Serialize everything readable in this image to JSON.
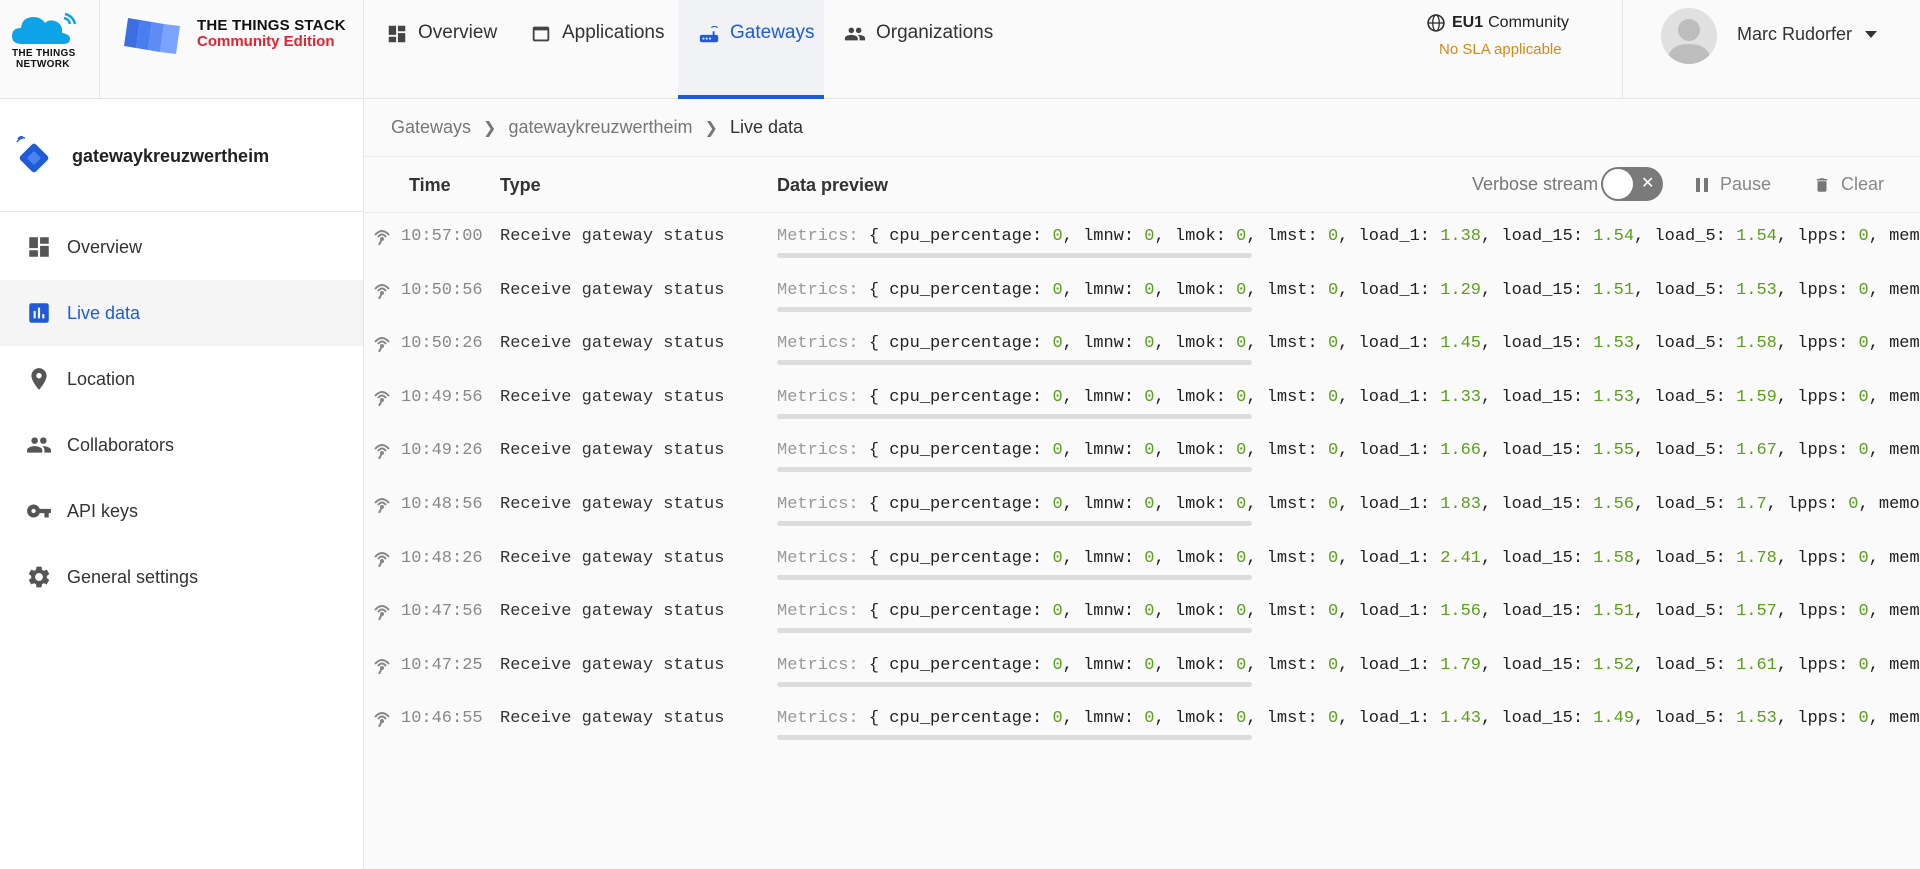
{
  "header": {
    "ttn_logo_text": [
      "THE THINGS",
      "NETWORK"
    ],
    "stack_title": "THE THINGS STACK",
    "stack_subtitle": "Community Edition",
    "nav": [
      {
        "label": "Overview",
        "icon": "dashboard-icon",
        "active": false
      },
      {
        "label": "Applications",
        "icon": "window-icon",
        "active": false
      },
      {
        "label": "Gateways",
        "icon": "router-icon",
        "active": true
      },
      {
        "label": "Organizations",
        "icon": "people-icon",
        "active": false
      }
    ],
    "cluster_name": "EU1",
    "cluster_type": "Community",
    "sla_text": "No SLA applicable",
    "user_name": "Marc Rudorfer"
  },
  "sidebar": {
    "entity_name": "gatewaykreuzwertheim",
    "items": [
      {
        "label": "Overview",
        "icon": "dashboard-icon",
        "active": false
      },
      {
        "label": "Live data",
        "icon": "bar-chart-icon",
        "active": true
      },
      {
        "label": "Location",
        "icon": "location-pin-icon",
        "active": false
      },
      {
        "label": "Collaborators",
        "icon": "people-icon",
        "active": false
      },
      {
        "label": "API keys",
        "icon": "key-icon",
        "active": false
      },
      {
        "label": "General settings",
        "icon": "gear-icon",
        "active": false
      }
    ]
  },
  "breadcrumb": [
    "Gateways",
    "gatewaykreuzwertheim",
    "Live data"
  ],
  "table": {
    "headers": {
      "time": "Time",
      "type": "Type",
      "preview": "Data preview"
    },
    "verbose_label": "Verbose stream",
    "pause_label": "Pause",
    "clear_label": "Clear",
    "rows": [
      {
        "time": "10:57:00",
        "type": "Receive gateway status",
        "load_1": "1.38",
        "load_15": "1.54",
        "load_5": "1.54"
      },
      {
        "time": "10:50:56",
        "type": "Receive gateway status",
        "load_1": "1.29",
        "load_15": "1.51",
        "load_5": "1.53"
      },
      {
        "time": "10:50:26",
        "type": "Receive gateway status",
        "load_1": "1.45",
        "load_15": "1.53",
        "load_5": "1.58"
      },
      {
        "time": "10:49:56",
        "type": "Receive gateway status",
        "load_1": "1.33",
        "load_15": "1.53",
        "load_5": "1.59"
      },
      {
        "time": "10:49:26",
        "type": "Receive gateway status",
        "load_1": "1.66",
        "load_15": "1.55",
        "load_5": "1.67"
      },
      {
        "time": "10:48:56",
        "type": "Receive gateway status",
        "load_1": "1.83",
        "load_15": "1.56",
        "load_5": "1.7"
      },
      {
        "time": "10:48:26",
        "type": "Receive gateway status",
        "load_1": "2.41",
        "load_15": "1.58",
        "load_5": "1.78"
      },
      {
        "time": "10:47:56",
        "type": "Receive gateway status",
        "load_1": "1.56",
        "load_15": "1.51",
        "load_5": "1.57"
      },
      {
        "time": "10:47:25",
        "type": "Receive gateway status",
        "load_1": "1.79",
        "load_15": "1.52",
        "load_5": "1.61"
      },
      {
        "time": "10:46:55",
        "type": "Receive gateway status",
        "load_1": "1.43",
        "load_15": "1.49",
        "load_5": "1.53"
      }
    ],
    "preview_prefix": "Metrics:",
    "zero_value": "0",
    "trailing_key": "memory_pe"
  },
  "colors": {
    "accent": "#1f5bd8",
    "brand_red": "#e02435",
    "number_green": "#5c9e1e",
    "sla_orange": "#d08a1a"
  }
}
